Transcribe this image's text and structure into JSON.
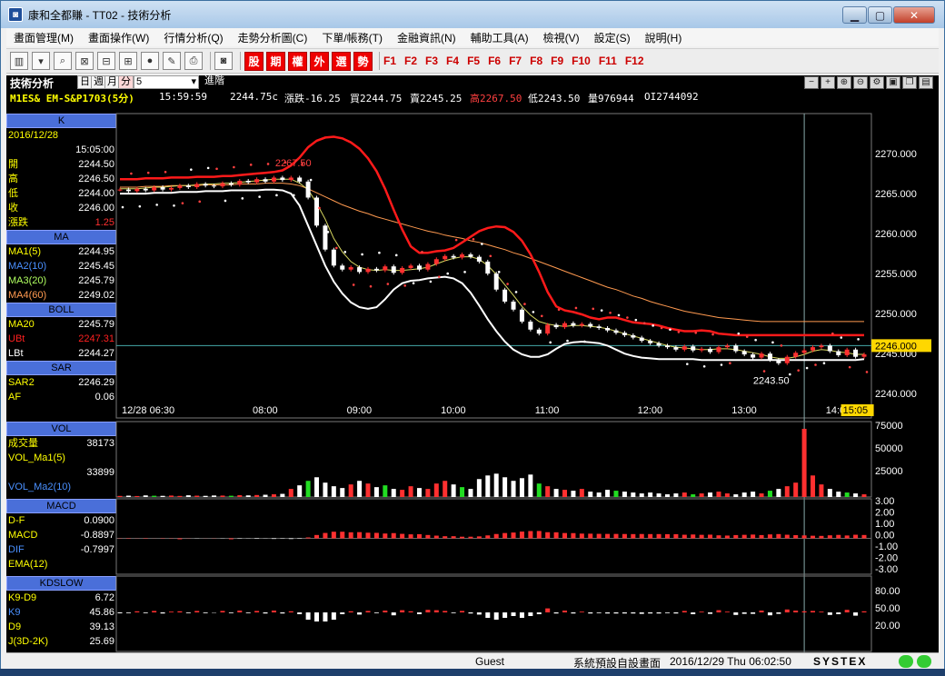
{
  "window": {
    "title": "康和全都賺 - TT02 - 技術分析",
    "app_icon": "app-logo-icon"
  },
  "menu": [
    "畫面管理(M)",
    "畫面操作(W)",
    "行情分析(Q)",
    "走勢分析圖(C)",
    "下單/帳務(T)",
    "金融資訊(N)",
    "輔助工具(A)",
    "檢視(V)",
    "設定(S)",
    "說明(H)"
  ],
  "toolbar": {
    "red_buttons": [
      "股",
      "期",
      "權",
      "外",
      "選",
      "勢"
    ],
    "fkeys": [
      "F1",
      "F2",
      "F3",
      "F4",
      "F5",
      "F6",
      "F7",
      "F8",
      "F9",
      "F10",
      "F11",
      "F12"
    ]
  },
  "panel": {
    "title": "技術分析",
    "periods": [
      "日",
      "週",
      "月",
      "分"
    ],
    "interval": "5",
    "advanced": "進階",
    "symbol": "M1ES& EM-S&P1703(5分)",
    "time": "15:59:59",
    "price": "2244.75c",
    "change": "漲跌-16.25",
    "bid": "買2244.75",
    "ask": "賣2245.25",
    "high": "高2267.50",
    "low": "低2243.50",
    "volume": "量976944",
    "oi": "OI2744092"
  },
  "side": {
    "k_head": "K",
    "date": "2016/12/28",
    "time": "15:05:00",
    "ohlc": [
      {
        "k": "開",
        "v": "2244.50"
      },
      {
        "k": "高",
        "v": "2246.50"
      },
      {
        "k": "低",
        "v": "2244.00"
      },
      {
        "k": "收",
        "v": "2246.00"
      },
      {
        "k": "漲跌",
        "v": "1.25"
      }
    ],
    "ma_head": "MA",
    "ma": [
      {
        "k": "MA1(5)",
        "v": "2244.95",
        "c": "#ffff00"
      },
      {
        "k": "MA2(10)",
        "v": "2245.45",
        "c": "#4a90ff"
      },
      {
        "k": "MA3(20)",
        "v": "2245.79",
        "c": "#b0ff60"
      },
      {
        "k": "MA4(60)",
        "v": "2249.02",
        "c": "#ff9a50"
      }
    ],
    "boll_head": "BOLL",
    "boll": [
      {
        "k": "MA20",
        "v": "2245.79",
        "c": "#ffff00"
      },
      {
        "k": "UBt",
        "v": "2247.31",
        "c": "#ff2020"
      },
      {
        "k": "LBt",
        "v": "2244.27",
        "c": "#ffffff"
      }
    ],
    "sar_head": "SAR",
    "sar": [
      {
        "k": "SAR2",
        "v": "2246.29",
        "c": "#ffff00"
      },
      {
        "k": "AF",
        "v": "0.06",
        "c": "#ffff00"
      }
    ],
    "vol_head": "VOL",
    "vol": [
      {
        "k": "成交量",
        "v": "38173",
        "c": "#ffff00"
      },
      {
        "k": "VOL_Ma1(5)",
        "v": "",
        "c": "#ffff00"
      },
      {
        "k": "",
        "v": "33899",
        "c": "#ffff00"
      },
      {
        "k": "VOL_Ma2(10)",
        "v": "",
        "c": "#4a90ff"
      }
    ],
    "macd_head": "MACD",
    "macd": [
      {
        "k": "D-F",
        "v": "0.0900",
        "c": "#ffff00"
      },
      {
        "k": "MACD",
        "v": "-0.8897",
        "c": "#ffff00"
      },
      {
        "k": "DIF",
        "v": "-0.7997",
        "c": "#4a90ff"
      },
      {
        "k": "EMA(12)",
        "v": "",
        "c": "#ffff00"
      }
    ],
    "kd_head": "KDSLOW",
    "kd": [
      {
        "k": "K9-D9",
        "v": "6.72",
        "c": "#ffff00"
      },
      {
        "k": "K9",
        "v": "45.86",
        "c": "#4a90ff"
      },
      {
        "k": "D9",
        "v": "39.13",
        "c": "#ffff00"
      },
      {
        "k": "J(3D-2K)",
        "v": "25.69",
        "c": "#ffff00"
      }
    ]
  },
  "chart_data": {
    "type": "line",
    "title": "",
    "x_ticks": [
      "12/28 06:30",
      "08:00",
      "09:00",
      "10:00",
      "11:00",
      "12:00",
      "13:00",
      "14:00",
      "15:05"
    ],
    "y_ticks": [
      "2270.000",
      "2265.000",
      "2260.000",
      "2255.000",
      "2250.000",
      "2245.000",
      "2240.000"
    ],
    "ylim": [
      2239,
      2275
    ],
    "current_price": "2246.000",
    "high_label": "2267.50",
    "low_label": "2243.50",
    "vol_ticks": [
      "75000",
      "50000",
      "25000"
    ],
    "macd_ticks": [
      "3.00",
      "2.00",
      "1.00",
      "0.00",
      "-1.00",
      "-2.00",
      "-3.00"
    ],
    "kd_ticks": [
      "80.00",
      "50.00",
      "20.00"
    ],
    "close_series": [
      2265.5,
      2265.3,
      2265.6,
      2265.4,
      2265.8,
      2265.5,
      2265.7,
      2266.0,
      2265.8,
      2266.2,
      2266.0,
      2265.9,
      2266.3,
      2266.1,
      2266.6,
      2266.4,
      2266.8,
      2266.5,
      2267.0,
      2266.7,
      2267.0,
      2266.5,
      2264.5,
      2261.0,
      2258.0,
      2256.0,
      2255.5,
      2255.8,
      2255.2,
      2255.6,
      2255.4,
      2255.9,
      2255.1,
      2255.7,
      2256.0,
      2255.5,
      2256.2,
      2256.8,
      2257.2,
      2257.0,
      2257.4,
      2257.1,
      2256.5,
      2255.0,
      2253.0,
      2251.5,
      2250.5,
      2249.0,
      2248.0,
      2247.5,
      2248.6,
      2248.3,
      2248.8,
      2248.5,
      2248.7,
      2248.4,
      2248.2,
      2247.9,
      2247.6,
      2247.3,
      2247.0,
      2246.6,
      2246.3,
      2246.0,
      2245.8,
      2245.5,
      2245.9,
      2245.4,
      2245.6,
      2245.2,
      2245.8,
      2246.0,
      2245.3,
      2244.9,
      2244.5,
      2245.0,
      2244.2,
      2243.8,
      2244.6,
      2245.1,
      2245.4,
      2245.8,
      2246.0,
      2245.3,
      2244.8,
      2245.5,
      2244.6,
      2244.9
    ],
    "volume_series": [
      1200,
      1500,
      1100,
      1800,
      1400,
      1300,
      1600,
      1200,
      1900,
      1500,
      1300,
      1700,
      1600,
      1400,
      2000,
      1800,
      2200,
      2500,
      3000,
      3500,
      9000,
      13000,
      18000,
      22000,
      16000,
      12000,
      10000,
      14000,
      18000,
      15000,
      11000,
      13000,
      9000,
      8000,
      12000,
      10000,
      9000,
      15000,
      18000,
      14000,
      11000,
      9000,
      20000,
      24000,
      26000,
      22000,
      18000,
      21000,
      25000,
      15000,
      12000,
      9000,
      8000,
      7000,
      9000,
      6000,
      5000,
      8000,
      7000,
      6000,
      5000,
      4000,
      5000,
      4000,
      3000,
      4000,
      5000,
      3000,
      4000,
      5000,
      6000,
      4000,
      3000,
      5000,
      6000,
      4000,
      7000,
      9000,
      12000,
      16000,
      76000,
      24000,
      14000,
      9000,
      6000,
      5000,
      4000,
      3000
    ],
    "ma1": [
      2265.6,
      2265.6,
      2265.6,
      2265.7,
      2265.8,
      2265.8,
      2265.9,
      2266.0,
      2266.0,
      2266.1,
      2266.2,
      2266.2,
      2266.3,
      2266.3,
      2266.4,
      2266.5,
      2266.6,
      2266.7,
      2266.8,
      2266.8,
      2266.8,
      2266.3,
      2265.5,
      2263.8,
      2261.8,
      2259.4,
      2257.7,
      2256.5,
      2255.8,
      2255.5,
      2255.4,
      2255.5,
      2255.4,
      2255.4,
      2255.5,
      2255.6,
      2255.8,
      2256.2,
      2256.6,
      2256.9,
      2257.1,
      2257.1,
      2256.8,
      2256.0,
      2254.9,
      2253.6,
      2252.3,
      2250.9,
      2249.8,
      2249.0,
      2248.7,
      2248.5,
      2248.4,
      2248.5,
      2248.5,
      2248.4,
      2248.3,
      2248.1,
      2247.8,
      2247.5,
      2247.2,
      2246.9,
      2246.6,
      2246.3,
      2246.0,
      2245.8,
      2245.7,
      2245.6,
      2245.5,
      2245.5,
      2245.6,
      2245.6,
      2245.5,
      2245.3,
      2245.1,
      2244.9,
      2244.6,
      2244.4,
      2244.4,
      2244.6,
      2244.9,
      2245.3,
      2245.5,
      2245.4,
      2245.2,
      2245.1,
      2244.9,
      2244.9
    ],
    "ma4": [
      2265.8,
      2265.8,
      2265.8,
      2265.9,
      2265.9,
      2265.9,
      2266.0,
      2266.0,
      2266.0,
      2266.0,
      2266.1,
      2266.1,
      2266.1,
      2266.1,
      2266.2,
      2266.2,
      2266.2,
      2266.3,
      2266.3,
      2266.3,
      2266.2,
      2266.0,
      2265.6,
      2265.1,
      2264.6,
      2264.1,
      2263.6,
      2263.2,
      2262.8,
      2262.5,
      2262.1,
      2261.8,
      2261.5,
      2261.2,
      2260.9,
      2260.6,
      2260.3,
      2260.1,
      2259.8,
      2259.6,
      2259.4,
      2259.1,
      2258.9,
      2258.6,
      2258.3,
      2258.0,
      2257.6,
      2257.3,
      2256.9,
      2256.5,
      2256.1,
      2255.7,
      2255.3,
      2254.9,
      2254.5,
      2254.1,
      2253.7,
      2253.3,
      2253.0,
      2252.6,
      2252.2,
      2251.9,
      2251.5,
      2251.2,
      2250.9,
      2250.6,
      2250.3,
      2250.1,
      2249.9,
      2249.7,
      2249.5,
      2249.4,
      2249.3,
      2249.2,
      2249.1,
      2249.0,
      2249.0,
      2249.0,
      2249.0,
      2249.0,
      2249.0,
      2249.0,
      2249.0,
      2249.0,
      2249.0,
      2249.0,
      2249.0,
      2249.0
    ],
    "ubt": [
      2266.8,
      2266.8,
      2266.8,
      2266.9,
      2266.9,
      2266.9,
      2267.0,
      2267.0,
      2267.0,
      2267.1,
      2267.1,
      2267.1,
      2267.2,
      2267.2,
      2267.3,
      2267.4,
      2267.5,
      2267.6,
      2267.7,
      2267.9,
      2268.5,
      2269.5,
      2270.8,
      2271.6,
      2272.0,
      2272.1,
      2271.9,
      2271.4,
      2270.6,
      2269.4,
      2267.8,
      2265.6,
      2263.0,
      2260.5,
      2258.4,
      2257.6,
      2257.6,
      2257.8,
      2257.9,
      2258.2,
      2258.9,
      2259.6,
      2260.3,
      2260.7,
      2260.9,
      2260.8,
      2260.2,
      2259.1,
      2257.4,
      2255.2,
      2252.7,
      2250.9,
      2250.4,
      2250.2,
      2249.9,
      2249.5,
      2249.3,
      2249.5,
      2249.5,
      2249.2,
      2248.9,
      2248.8,
      2248.7,
      2248.5,
      2248.2,
      2248.0,
      2247.8,
      2247.8,
      2247.9,
      2247.8,
      2247.5,
      2247.4,
      2247.3,
      2247.3,
      2247.3,
      2247.3,
      2247.3,
      2247.3,
      2247.3,
      2247.3,
      2247.3,
      2247.3,
      2247.3,
      2247.3,
      2247.3,
      2247.3,
      2247.3,
      2247.3
    ],
    "lbt": [
      2265.0,
      2265.0,
      2265.0,
      2265.0,
      2265.1,
      2265.1,
      2265.1,
      2265.2,
      2265.2,
      2265.2,
      2265.3,
      2265.3,
      2265.3,
      2265.4,
      2265.4,
      2265.4,
      2265.4,
      2265.5,
      2265.5,
      2265.4,
      2265.0,
      2263.5,
      2261.0,
      2258.5,
      2256.0,
      2254.0,
      2252.5,
      2251.4,
      2250.8,
      2250.6,
      2250.8,
      2251.8,
      2253.0,
      2253.8,
      2254.1,
      2254.2,
      2254.4,
      2254.5,
      2254.6,
      2254.4,
      2253.8,
      2252.6,
      2251.0,
      2249.3,
      2247.8,
      2246.5,
      2245.5,
      2244.9,
      2244.6,
      2244.6,
      2244.9,
      2245.6,
      2246.2,
      2246.4,
      2246.5,
      2246.4,
      2246.3,
      2246.0,
      2245.5,
      2245.0,
      2244.7,
      2244.5,
      2244.4,
      2244.3,
      2244.3,
      2244.3,
      2244.3,
      2244.3,
      2244.2,
      2244.2,
      2244.2,
      2244.2,
      2244.2,
      2244.2,
      2244.2,
      2244.2,
      2244.2,
      2244.2,
      2244.2,
      2244.2,
      2244.2,
      2244.2,
      2244.2,
      2244.2,
      2244.2,
      2244.2,
      2244.2,
      2244.3
    ]
  },
  "status": {
    "user": "Guest",
    "screen": "系統預設自設畫面",
    "datetime": "2016/12/29 Thu 06:02:50",
    "brand": "SYSTEX"
  }
}
